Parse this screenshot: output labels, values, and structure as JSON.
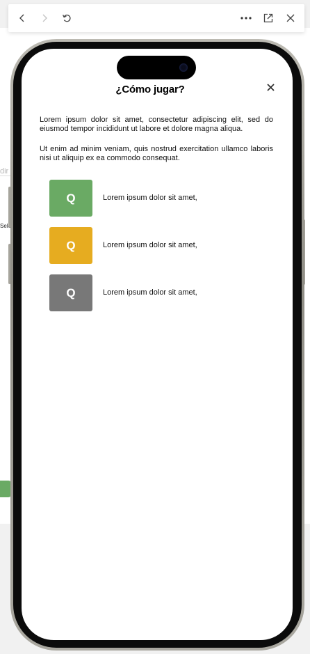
{
  "background": {
    "fragment_1": "dir",
    "fragment_2": "Sele",
    "accent_color": "#6aaa64"
  },
  "toolbar": {
    "back_icon": "chevron-left-icon",
    "forward_icon": "chevron-right-icon",
    "reload_icon": "reload-icon",
    "more_icon": "more-horizontal-icon",
    "open_external_icon": "open-external-icon",
    "close_icon": "close-icon"
  },
  "modal": {
    "title": "¿Cómo jugar?",
    "close_icon": "close-icon",
    "paragraph_1": "Lorem ipsum dolor sit amet, consectetur adipiscing elit, sed do eiusmod tempor incididunt ut labore et dolore magna aliqua.",
    "paragraph_2": " Ut enim ad minim veniam, quis nostrud exercitation ullamco laboris nisi ut aliquip ex ea commodo consequat.",
    "examples": [
      {
        "letter": "Q",
        "color": "#6aaa64",
        "text": "Lorem ipsum dolor sit amet,"
      },
      {
        "letter": "Q",
        "color": "#e6ac20",
        "text": "Lorem ipsum dolor sit amet,"
      },
      {
        "letter": "Q",
        "color": "#787878",
        "text": "Lorem ipsum dolor sit amet,"
      }
    ]
  }
}
